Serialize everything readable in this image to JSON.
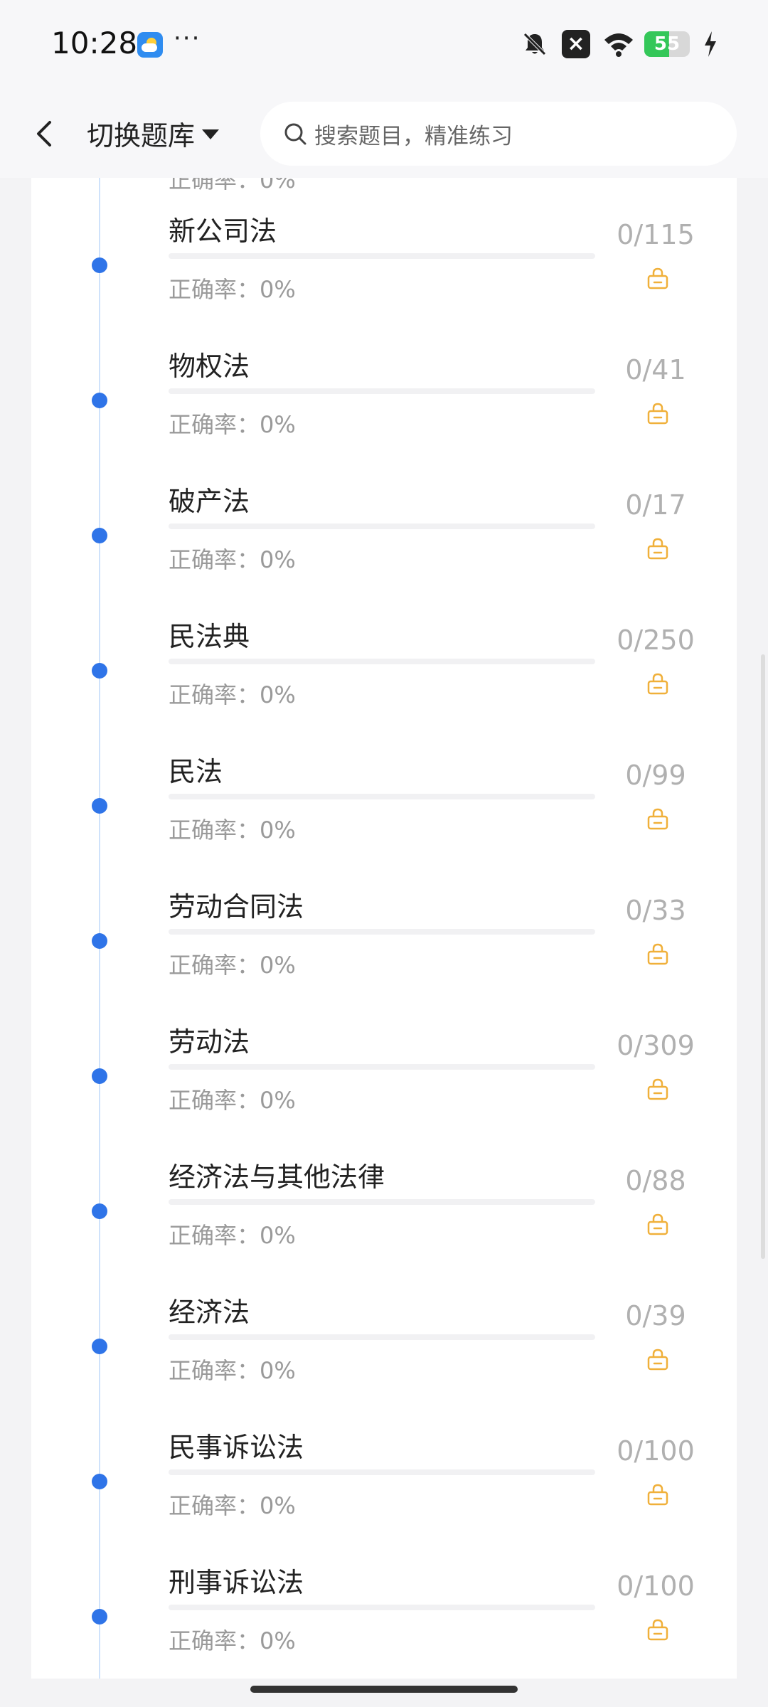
{
  "status_bar": {
    "time": "10:28",
    "dots": "···",
    "battery_level": "55",
    "icons": [
      "weather-icon",
      "bell-off-icon",
      "close-box-icon",
      "wifi-icon",
      "battery-icon",
      "charging-bolt-icon"
    ]
  },
  "header": {
    "switch_bank_label": "切换题库",
    "search_placeholder": "搜索题目，精准练习"
  },
  "accuracy_label": "正确率：0%",
  "items": [
    {
      "title": "新公司法",
      "count": "0/115",
      "accuracy": "正确率：0%"
    },
    {
      "title": "物权法",
      "count": "0/41",
      "accuracy": "正确率：0%"
    },
    {
      "title": "破产法",
      "count": "0/17",
      "accuracy": "正确率：0%"
    },
    {
      "title": "民法典",
      "count": "0/250",
      "accuracy": "正确率：0%"
    },
    {
      "title": "民法",
      "count": "0/99",
      "accuracy": "正确率：0%"
    },
    {
      "title": "劳动合同法",
      "count": "0/33",
      "accuracy": "正确率：0%"
    },
    {
      "title": "劳动法",
      "count": "0/309",
      "accuracy": "正确率：0%"
    },
    {
      "title": "经济法与其他法律",
      "count": "0/88",
      "accuracy": "正确率：0%"
    },
    {
      "title": "经济法",
      "count": "0/39",
      "accuracy": "正确率：0%"
    },
    {
      "title": "民事诉讼法",
      "count": "0/100",
      "accuracy": "正确率：0%"
    },
    {
      "title": "刑事诉讼法",
      "count": "0/100",
      "accuracy": "正确率：0%"
    }
  ],
  "colors": {
    "accent": "#2f74e8",
    "lock": "#f0b03a",
    "count": "#b0b0b0"
  }
}
